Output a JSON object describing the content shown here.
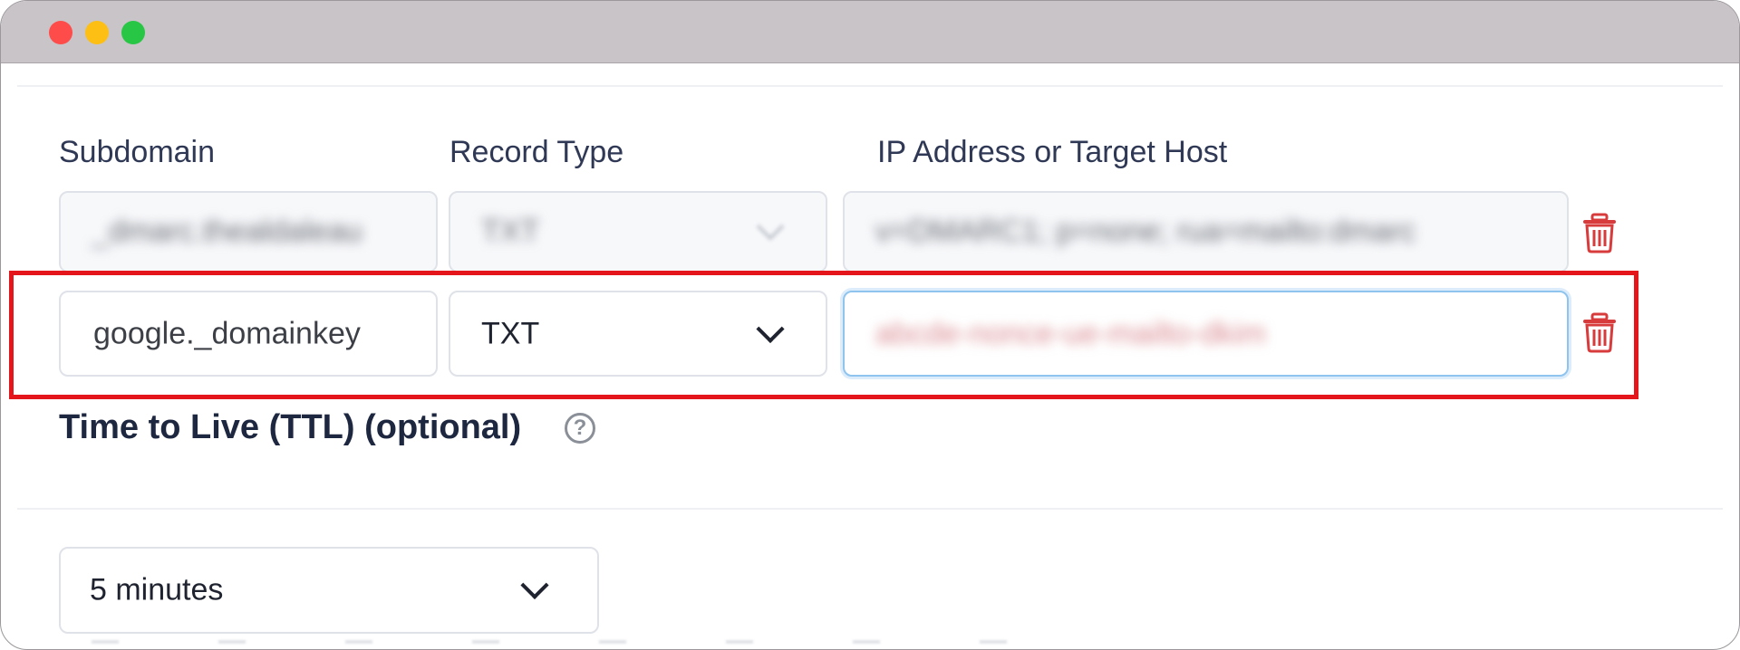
{
  "window": {
    "controls": [
      "close",
      "minimize",
      "maximize"
    ]
  },
  "form": {
    "labels": {
      "subdomain": "Subdomain",
      "record_type": "Record Type",
      "target": "IP Address or Target Host"
    },
    "row1": {
      "subdomain": "_dmarc.thealdaleau",
      "record_type": "TXT",
      "target": "v=DMARC1; p=none; rua=mailto:dmarc"
    },
    "row2": {
      "subdomain": "google._domainkey",
      "record_type": "TXT",
      "target": "abcde-nonce-ue-mailto-dkim"
    }
  },
  "ttl": {
    "label": "Time to Live (TTL) (optional)",
    "help_glyph": "?",
    "value": "5 minutes"
  },
  "colors": {
    "highlight": "#e4161b",
    "delete": "#d83b3b",
    "focus": "#8fc4ef"
  },
  "icons": [
    "trash-icon",
    "chevron-down-icon",
    "help-icon"
  ]
}
